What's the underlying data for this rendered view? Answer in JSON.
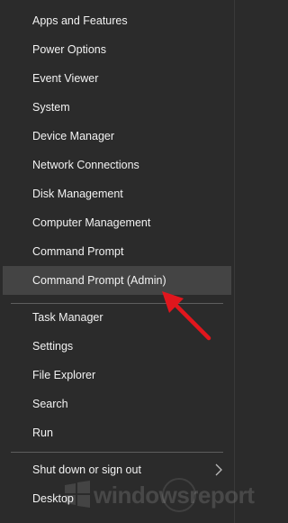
{
  "menu": {
    "items": [
      {
        "label": "Apps and Features"
      },
      {
        "label": "Power Options"
      },
      {
        "label": "Event Viewer"
      },
      {
        "label": "System"
      },
      {
        "label": "Device Manager"
      },
      {
        "label": "Network Connections"
      },
      {
        "label": "Disk Management"
      },
      {
        "label": "Computer Management"
      },
      {
        "label": "Command Prompt"
      },
      {
        "label": "Command Prompt (Admin)"
      },
      {
        "label": "Task Manager"
      },
      {
        "label": "Settings"
      },
      {
        "label": "File Explorer"
      },
      {
        "label": "Search"
      },
      {
        "label": "Run"
      },
      {
        "label": "Shut down or sign out"
      },
      {
        "label": "Desktop"
      }
    ],
    "highlighted_item": "Command Prompt (Admin)"
  },
  "watermark": {
    "text": "windowsreport"
  },
  "icons": {
    "submenu": "chevron-right-icon",
    "annotation": "red-arrow-icon",
    "watermark_logo": "windows-logo-icon"
  },
  "colors": {
    "background": "#2b2b2b",
    "highlight": "#444444",
    "text": "#f2f2f2",
    "separator": "#5e5e5e",
    "arrow": "#e0161d"
  }
}
